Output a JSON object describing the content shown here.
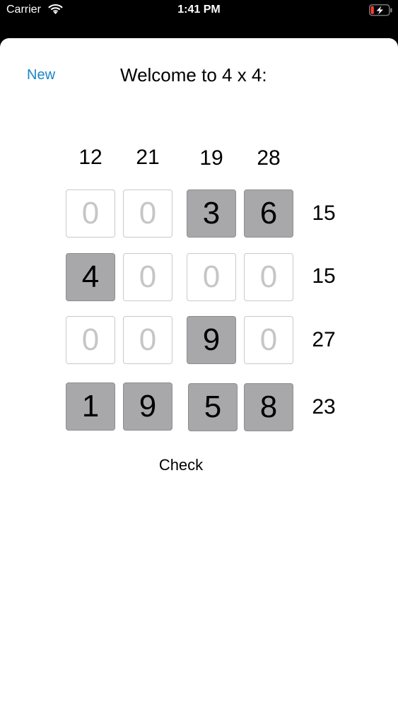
{
  "status_bar": {
    "carrier": "Carrier",
    "time": "1:41 PM",
    "wifi_icon": "wifi-icon",
    "battery_icon": "battery-charging-icon",
    "battery_color": "#ff3b30"
  },
  "header": {
    "new_label": "New",
    "title": "Welcome to 4 x 4:"
  },
  "puzzle": {
    "column_sums": [
      "12",
      "21",
      "19",
      "28"
    ],
    "row_sums": [
      "15",
      "15",
      "27",
      "23"
    ],
    "cells": [
      [
        "0",
        "0",
        "3",
        "6"
      ],
      [
        "4",
        "0",
        "0",
        "0"
      ],
      [
        "0",
        "0",
        "9",
        "0"
      ],
      [
        "1",
        "9",
        "5",
        "8"
      ]
    ]
  },
  "footer": {
    "check_label": "Check"
  },
  "colors": {
    "accent": "#1a84c8",
    "filled_cell": "#a8a8aa",
    "empty_digit": "#c6c6c6"
  }
}
